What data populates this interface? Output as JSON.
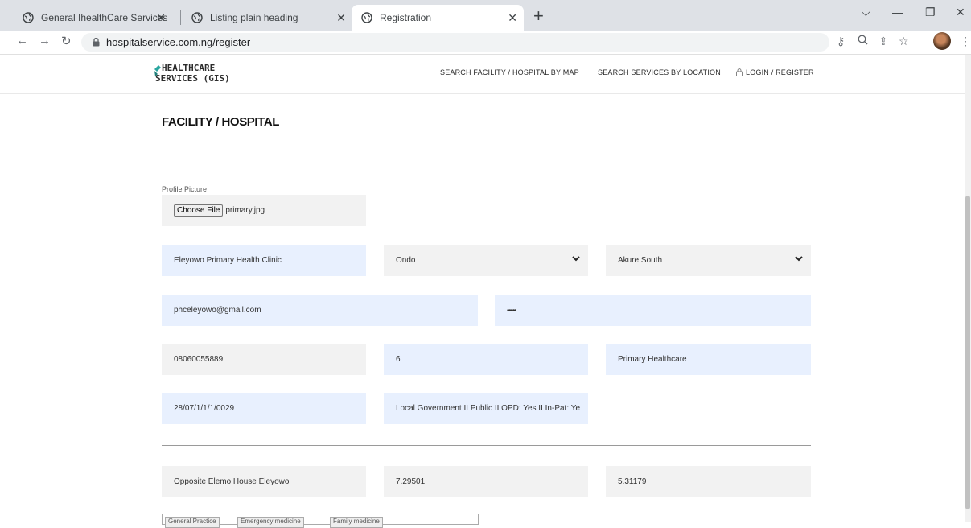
{
  "browser": {
    "tabs": [
      {
        "title": "General IhealthCare Services"
      },
      {
        "title": "Listing plain heading"
      },
      {
        "title": "Registration"
      }
    ],
    "url": "hospitalservice.com.ng/register"
  },
  "header": {
    "logo_line1": "HEALTHCARE",
    "logo_line2": "SERVICES (GIS)",
    "nav": {
      "map": "SEARCH FACILITY / HOSPITAL BY MAP",
      "location": "SEARCH SERVICES BY LOCATION",
      "login": "LOGIN / REGISTER"
    }
  },
  "form": {
    "title": "FACILITY / HOSPITAL",
    "profile_label": "Profile Picture",
    "file_button": "Choose File",
    "file_name": "primary.jpg",
    "name": "Eleyowo Primary Health Clinic",
    "state": "Ondo",
    "lga": "Akure South",
    "email": "phceleyowo@gmail.com",
    "password": "••••••",
    "phone": "08060055889",
    "number_field": "6",
    "category": "Primary Healthcare",
    "reg_code": "28/07/1/1/1/0029",
    "ownership": "Local Government II Public II OPD: Yes II In-Pat: Ye",
    "address": "Opposite Elemo House Eleyowo",
    "latitude": "7.29501",
    "longitude": "5.31179",
    "services": [
      "General Practice",
      "Emergency medicine",
      "Family medicine"
    ]
  }
}
